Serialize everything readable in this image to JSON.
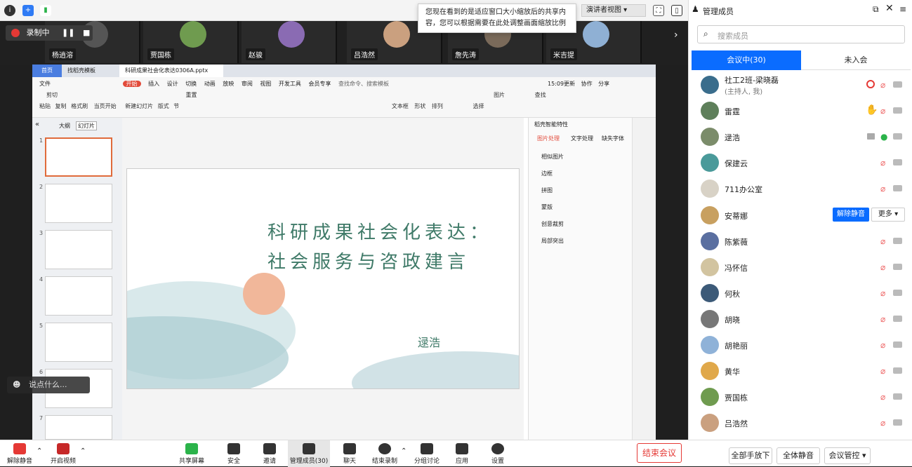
{
  "notice": "您现在看到的是适应窗口大小缩放后的共享内容，您可以根据需要在此处调整画面缩放比例",
  "presenter_view": "演讲者视图",
  "recording": {
    "label": "录制中"
  },
  "strip_names": [
    "杨逍溶",
    "贾国栋",
    "赵骏",
    "吕浩然",
    "詹先涛",
    "米吉提"
  ],
  "wps": {
    "tab_home": "首页",
    "tab_template": "找稻壳模板",
    "tab_file": "科研成果社会化表达0306A.pptx",
    "menu": [
      "文件",
      "开始",
      "插入",
      "设计",
      "切换",
      "动画",
      "放映",
      "审阅",
      "视图",
      "开发工具",
      "会员专享"
    ],
    "search": "查找命令、搜索模板",
    "right_menu": [
      "15:09更新",
      "协作",
      "分享"
    ],
    "ribbon": [
      "粘贴",
      "剪切",
      "复制",
      "格式刷",
      "当页开始",
      "新建幻灯片",
      "版式",
      "节",
      "重置",
      "文本框",
      "形状",
      "排列",
      "图片",
      "查找",
      "选择"
    ],
    "thumb_tabs": [
      "大纲",
      "幻灯片"
    ],
    "slide_nums": [
      "1",
      "2",
      "3",
      "4",
      "5",
      "6",
      "7"
    ],
    "slide_title_l1": "科研成果社会化表达：",
    "slide_title_l2": "社会服务与咨政建言",
    "slide_author": "逯浩",
    "pane_title": "稻壳智能特性",
    "pane_tabs": [
      "图片处理",
      "文字处理",
      "缺失字体"
    ],
    "pane_items": [
      "相似图片",
      "边框",
      "拼图",
      "蒙版",
      "创意裁剪",
      "局部突出"
    ]
  },
  "chat_hint": "说点什么...",
  "panel": {
    "title": "管理成员",
    "search_placeholder": "搜索成员",
    "tab_in": "会议中(30)",
    "tab_out": "未入会",
    "host_role": "(主持人, 我)",
    "unmute_btn": "解除静音",
    "more_btn": "更多",
    "members": [
      "社工2班-梁晓磊",
      "雷霆",
      "逯浩",
      "保建云",
      "711办公室",
      "安蒂娜",
      "陈紫薇",
      "冯怀信",
      "何秋",
      "胡晓",
      "胡艳丽",
      "黄华",
      "贾国栋",
      "吕浩然"
    ],
    "foot": [
      "全部手放下",
      "全体静音",
      "会议管控"
    ]
  },
  "toolbar": {
    "unmute": "解除静音",
    "video": "开启视频",
    "share": "共享屏幕",
    "security": "安全",
    "invite": "邀请",
    "manage": "管理成员(30)",
    "chat": "聊天",
    "stop_rec": "结束录制",
    "breakout": "分组讨论",
    "apps": "应用",
    "settings": "设置",
    "end": "结束会议"
  },
  "colors": {
    "accent": "#0a6cff",
    "danger": "#e53935",
    "slide_green": "#3f7a68"
  }
}
